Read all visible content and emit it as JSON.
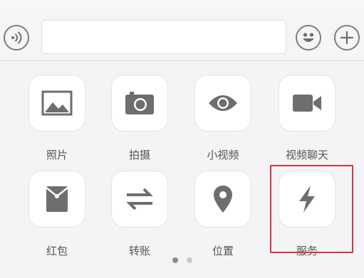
{
  "input_bar": {
    "voice_icon": "voice-wave-icon",
    "text_value": "",
    "emoji_icon": "smiley-icon",
    "plus_icon": "plus-icon"
  },
  "panel": {
    "items": [
      {
        "label": "照片",
        "icon": "photo-icon"
      },
      {
        "label": "拍摄",
        "icon": "camera-icon"
      },
      {
        "label": "小视频",
        "icon": "eye-icon"
      },
      {
        "label": "视频聊天",
        "icon": "video-camera-icon"
      },
      {
        "label": "红包",
        "icon": "red-packet-icon"
      },
      {
        "label": "转账",
        "icon": "transfer-arrows-icon"
      },
      {
        "label": "位置",
        "icon": "location-pin-icon"
      },
      {
        "label": "服务",
        "icon": "lightning-icon"
      }
    ],
    "page_indicator": {
      "total": 2,
      "current": 1
    },
    "highlighted_item": "服务",
    "highlight_color": "#d9363e",
    "icon_color": "#6e6e70"
  }
}
